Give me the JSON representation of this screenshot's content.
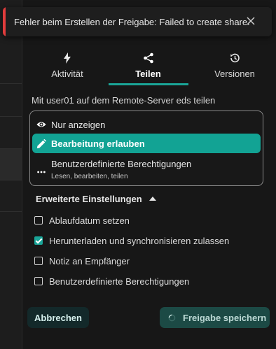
{
  "toast": {
    "message": "Fehler beim Erstellen der Freigabe: Failed to create share.",
    "close_icon": "close-icon",
    "accent_color": "#e23c3c"
  },
  "tabs": [
    {
      "label": "Aktivität",
      "icon": "lightning-icon"
    },
    {
      "label": "Teilen",
      "icon": "share-icon",
      "active": true
    },
    {
      "label": "Versionen",
      "icon": "history-icon"
    }
  ],
  "share": {
    "title": "Mit user01 auf dem Remote-Server eds teilen"
  },
  "permissions": {
    "options": [
      {
        "label": "Nur anzeigen",
        "icon": "eye-icon"
      },
      {
        "label": "Bearbeitung erlauben",
        "icon": "pencil-icon",
        "selected": true
      },
      {
        "label": "Benutzerdefinierte Berechtigungen",
        "sublabel": "Lesen, bearbeiten, teilen",
        "icon": "dots-icon"
      }
    ],
    "selected_color": "#12a394"
  },
  "advanced": {
    "label": "Erweiterte Einstellungen",
    "expanded": true,
    "checkboxes": [
      {
        "label": "Ablaufdatum setzen",
        "checked": false
      },
      {
        "label": "Herunterladen und synchronisieren zulassen",
        "checked": true
      },
      {
        "label": "Notiz an Empfänger",
        "checked": false
      },
      {
        "label": "Benutzerdefinierte Berechtigungen",
        "checked": false
      }
    ]
  },
  "footer": {
    "cancel_label": "Abbrechen",
    "save_label": "Freigabe speichern"
  },
  "colors": {
    "accent": "#1aa598",
    "background": "#171717"
  }
}
